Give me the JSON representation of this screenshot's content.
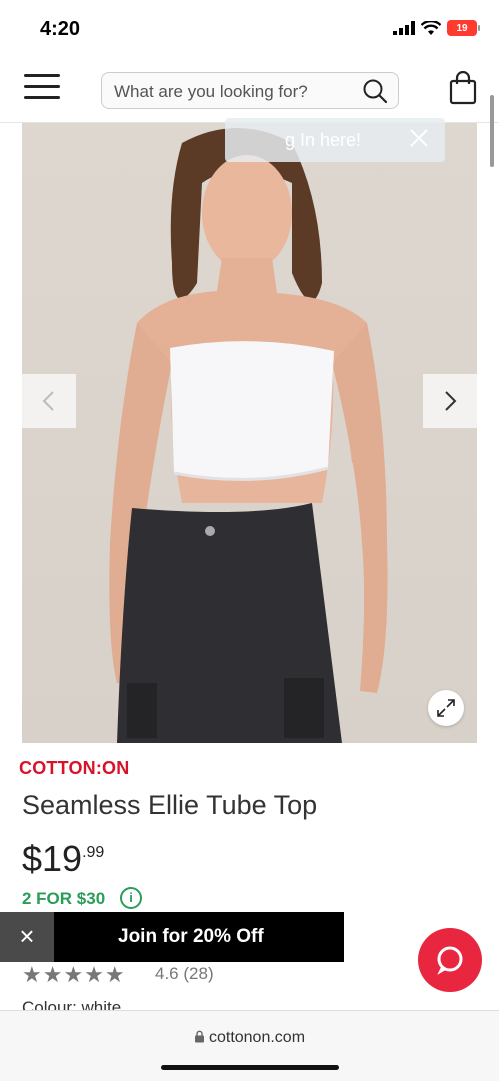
{
  "status": {
    "time": "4:20",
    "battery": "19"
  },
  "header": {
    "search_placeholder": "What are you looking for?"
  },
  "tooltip": {
    "text": "g In here!"
  },
  "product": {
    "brand": "COTTON:ON",
    "title": "Seamless Ellie Tube Top",
    "price_dollars": "$19",
    "price_cents": ".99",
    "promo": "2 FOR $30",
    "promo_info_icon": "i",
    "rating": "4.6",
    "review_count": "(28)",
    "colour_label": "Colour: white",
    "stars_filled": 4.5
  },
  "banner": {
    "close": "×",
    "text": "Join for 20% Off"
  },
  "browser": {
    "url": "cottonon.com"
  },
  "colors": {
    "brand_red": "#d9122a",
    "promo_green": "#2a9d57",
    "chat_red": "#e8263f"
  },
  "icons": [
    "hamburger-icon",
    "search-icon",
    "bag-icon",
    "close-icon",
    "chevron-left-icon",
    "chevron-right-icon",
    "expand-icon",
    "info-icon",
    "chat-icon",
    "lock-icon"
  ]
}
